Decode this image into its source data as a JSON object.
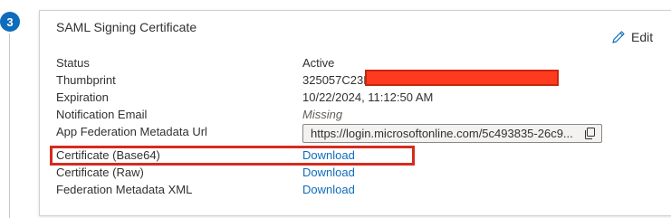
{
  "step": {
    "number": "3"
  },
  "card": {
    "title": "SAML Signing Certificate",
    "edit_label": "Edit"
  },
  "rows": [
    {
      "label": "Status",
      "value": "Active"
    },
    {
      "label": "Thumbprint",
      "value": "325057C23ED"
    },
    {
      "label": "Expiration",
      "value": "10/22/2024, 11:12:50 AM"
    },
    {
      "label": "Notification Email",
      "value": "Missing"
    },
    {
      "label": "App Federation Metadata Url",
      "value": "https://login.microsoftonline.com/5c493835-26c9..."
    },
    {
      "label": "Certificate (Base64)",
      "value": "Download"
    },
    {
      "label": "Certificate (Raw)",
      "value": "Download"
    },
    {
      "label": "Federation Metadata XML",
      "value": "Download"
    }
  ],
  "icons": {
    "edit": "pencil-icon",
    "copy": "copy-icon"
  },
  "colors": {
    "accent": "#0f6cbd",
    "redaction": "#ff3b1f",
    "highlight_border": "#d52b1e"
  }
}
